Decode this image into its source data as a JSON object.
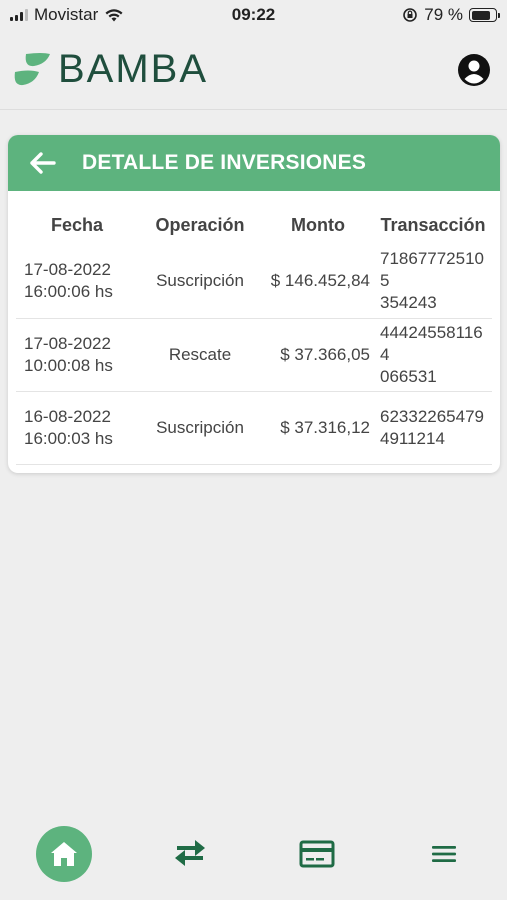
{
  "status_bar": {
    "carrier": "Movistar",
    "time": "09:22",
    "battery": "79 %",
    "battery_level": 0.79
  },
  "header": {
    "brand": "BAMBA"
  },
  "card": {
    "title": "DETALLE DE INVERSIONES",
    "columns": [
      "Fecha",
      "Operación",
      "Monto",
      "Transacción"
    ],
    "rows": [
      {
        "date": "17-08-2022",
        "time": "16:00:06 hs",
        "operation": "Suscripción",
        "amount": "$ 146.452,84",
        "transaction_1": "718677725105",
        "transaction_2": "354243"
      },
      {
        "date": "17-08-2022",
        "time": "10:00:08 hs",
        "operation": "Rescate",
        "amount": "$ 37.366,05",
        "transaction_1": "444245581164",
        "transaction_2": "066531"
      },
      {
        "date": "16-08-2022",
        "time": "16:00:03 hs",
        "operation": "Suscripción",
        "amount": "$ 37.316,12",
        "transaction_1": "62332265479",
        "transaction_2": "4911214"
      }
    ]
  },
  "nav": {
    "items": [
      "home-icon",
      "transfer-icon",
      "card-icon",
      "menu-icon"
    ]
  },
  "colors": {
    "accent": "#5db37e",
    "brand": "#1f4e3d"
  }
}
